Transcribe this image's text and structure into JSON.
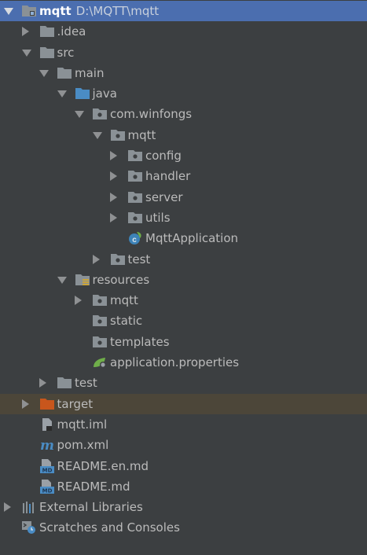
{
  "tree": [
    {
      "label": "mqtt",
      "path": "D:\\MQTT\\mqtt",
      "depth": 0,
      "arrow": "down",
      "icon": "module-folder-icon",
      "selected": true
    },
    {
      "label": ".idea",
      "depth": 1,
      "arrow": "right",
      "icon": "folder-icon"
    },
    {
      "label": "src",
      "depth": 1,
      "arrow": "down",
      "icon": "folder-icon"
    },
    {
      "label": "main",
      "depth": 2,
      "arrow": "down",
      "icon": "folder-icon"
    },
    {
      "label": "java",
      "depth": 3,
      "arrow": "down",
      "icon": "source-folder-icon"
    },
    {
      "label": "com.winfongs",
      "depth": 4,
      "arrow": "down",
      "icon": "package-icon"
    },
    {
      "label": "mqtt",
      "depth": 5,
      "arrow": "down",
      "icon": "package-icon"
    },
    {
      "label": "config",
      "depth": 6,
      "arrow": "right",
      "icon": "package-icon"
    },
    {
      "label": "handler",
      "depth": 6,
      "arrow": "right",
      "icon": "package-icon"
    },
    {
      "label": "server",
      "depth": 6,
      "arrow": "right",
      "icon": "package-icon"
    },
    {
      "label": "utils",
      "depth": 6,
      "arrow": "right",
      "icon": "package-icon"
    },
    {
      "label": "MqttApplication",
      "depth": 6,
      "arrow": "none",
      "icon": "spring-class-icon"
    },
    {
      "label": "test",
      "depth": 5,
      "arrow": "right",
      "icon": "package-icon"
    },
    {
      "label": "resources",
      "depth": 3,
      "arrow": "down",
      "icon": "resources-folder-icon"
    },
    {
      "label": "mqtt",
      "depth": 4,
      "arrow": "right",
      "icon": "package-icon"
    },
    {
      "label": "static",
      "depth": 4,
      "arrow": "none",
      "icon": "package-icon"
    },
    {
      "label": "templates",
      "depth": 4,
      "arrow": "none",
      "icon": "package-icon"
    },
    {
      "label": "application.properties",
      "depth": 4,
      "arrow": "none",
      "icon": "spring-properties-icon"
    },
    {
      "label": "test",
      "depth": 2,
      "arrow": "right",
      "icon": "folder-icon"
    },
    {
      "label": "target",
      "depth": 1,
      "arrow": "right",
      "icon": "excluded-folder-icon",
      "excluded": true
    },
    {
      "label": "mqtt.iml",
      "depth": 1,
      "arrow": "none",
      "icon": "iml-file-icon"
    },
    {
      "label": "pom.xml",
      "depth": 1,
      "arrow": "none",
      "icon": "maven-icon"
    },
    {
      "label": "README.en.md",
      "depth": 1,
      "arrow": "none",
      "icon": "markdown-icon"
    },
    {
      "label": "README.md",
      "depth": 1,
      "arrow": "none",
      "icon": "markdown-icon"
    },
    {
      "label": "External Libraries",
      "depth": 0,
      "arrow": "right",
      "icon": "libraries-icon"
    },
    {
      "label": "Scratches and Consoles",
      "depth": 0,
      "arrow": "none",
      "icon": "scratches-icon"
    }
  ],
  "colors": {
    "background": "#3c3f41",
    "selection": "#4b6eaf",
    "excluded_row": "#4c4639",
    "folder": "#8a9196",
    "source_folder": "#4a8cc4",
    "excluded_folder": "#c8561c",
    "spring_green": "#6fae4a"
  }
}
